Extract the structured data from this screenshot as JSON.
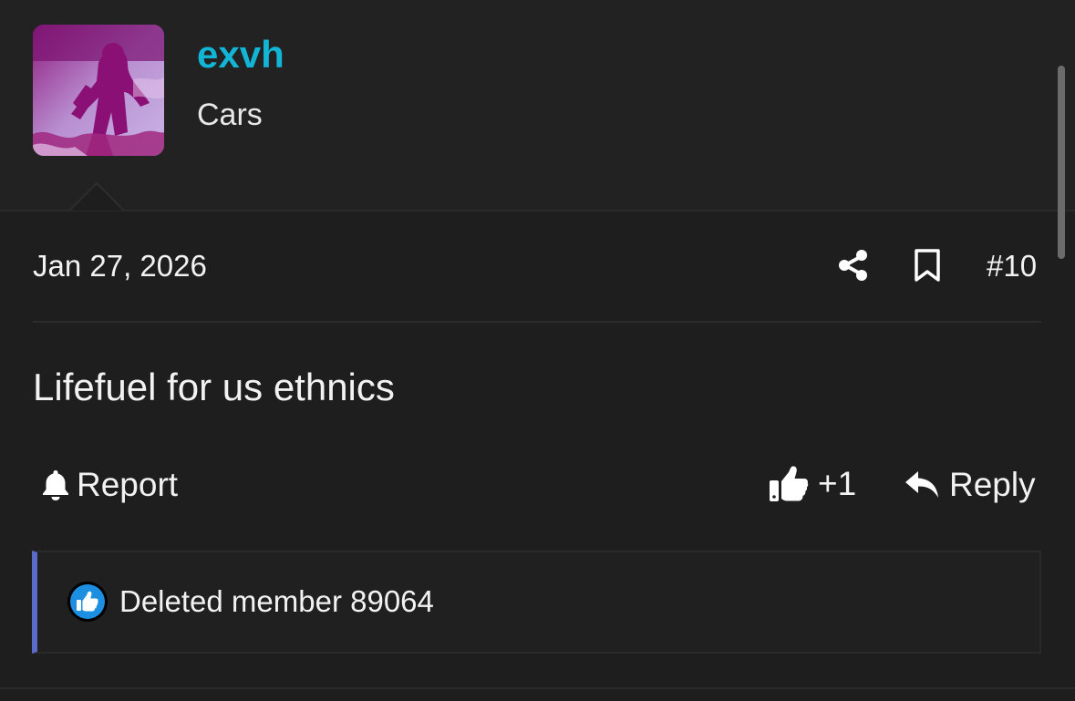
{
  "post": {
    "username": "exvh",
    "user_title": "Cars",
    "date": "Jan 27, 2026",
    "post_number": "#10",
    "body": "Lifefuel for us ethnics"
  },
  "actions": {
    "report_label": "Report",
    "like_count": "+1",
    "reply_label": "Reply"
  },
  "reactions": {
    "users": "Deleted member 89064"
  },
  "icons": {
    "share": "share-icon",
    "bookmark": "bookmark-icon",
    "report": "bell-icon",
    "like": "thumbs-up-icon",
    "reply": "reply-arrow-icon",
    "reaction": "like-reaction-icon"
  },
  "colors": {
    "background": "#1e1e1f",
    "header_background": "#222223",
    "username": "#13b5d6",
    "text": "#f2f2f2",
    "reactions_accent": "#5b6cc8",
    "reaction_badge": "#1d8fe0"
  }
}
